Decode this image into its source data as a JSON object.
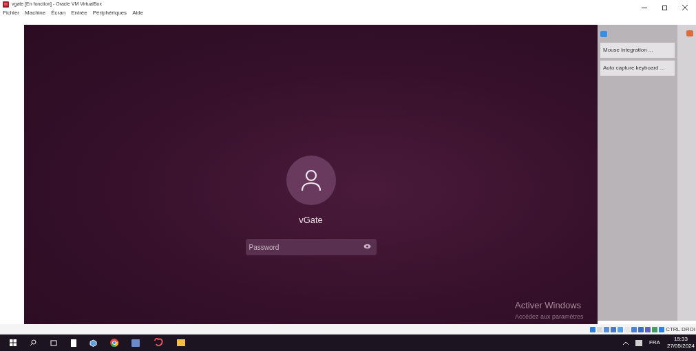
{
  "window": {
    "title": "vgate [En fonction] - Oracle VM VirtualBox"
  },
  "menu": [
    "Fichier",
    "Machine",
    "Écran",
    "Entrée",
    "Périphériques",
    "Aide"
  ],
  "login": {
    "user": "vGate",
    "password": {
      "placeholder": "Password"
    }
  },
  "activation": {
    "title": "Activer Windows",
    "subtitle": "Accédez aux paramètres"
  },
  "side_panel": {
    "items": [
      {
        "label": "Mouse integration ..."
      },
      {
        "label": "Auto capture keyboard ..."
      }
    ]
  },
  "status_bar": {
    "host_key": "CTRL DROI"
  },
  "taskbar": {
    "language": "FRA",
    "time": "15:33",
    "date": "27/05/2024"
  }
}
